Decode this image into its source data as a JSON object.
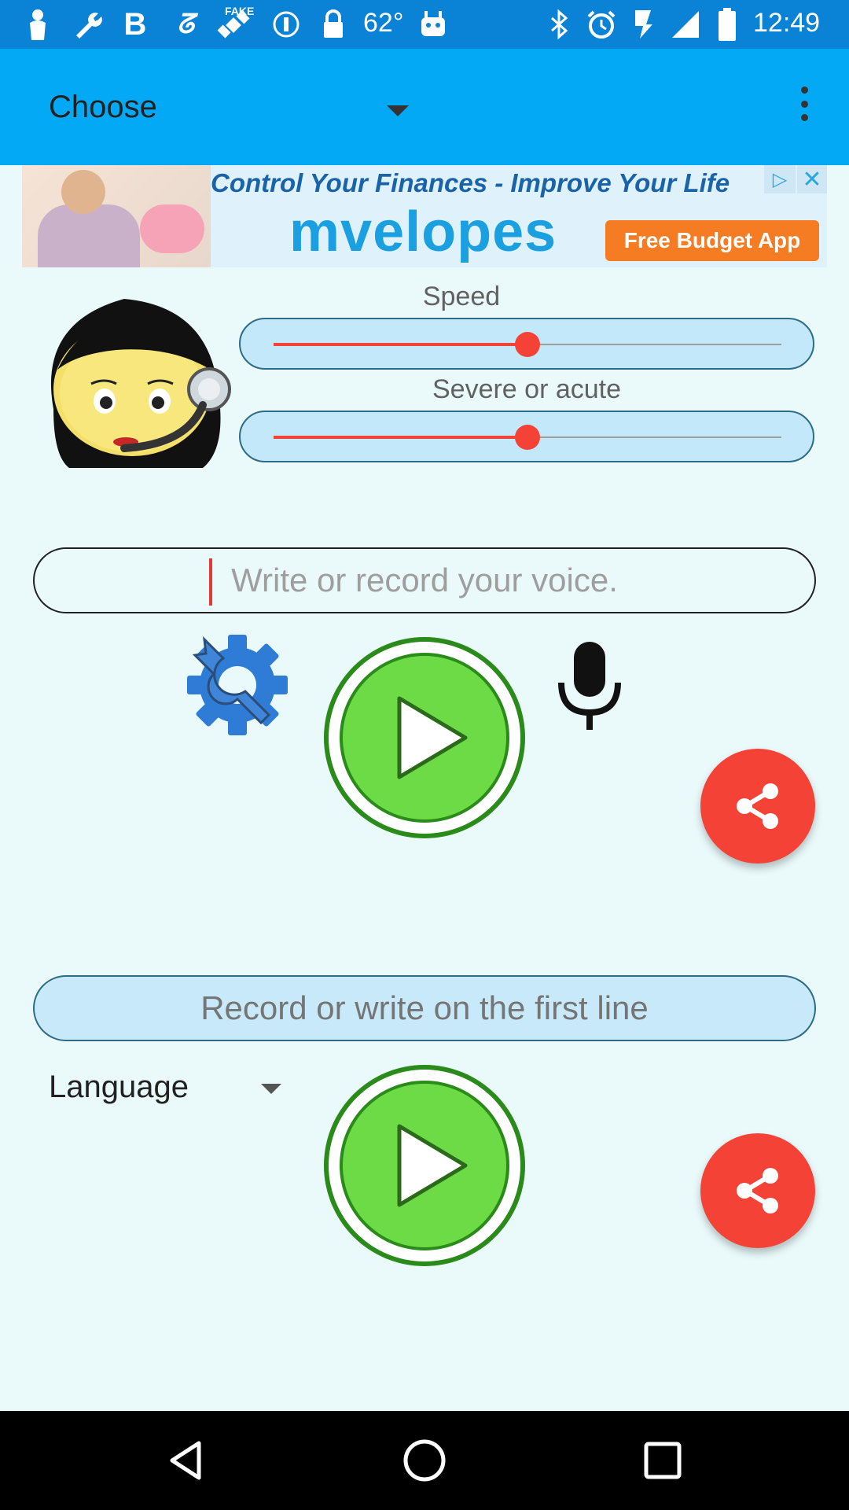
{
  "status_bar": {
    "temperature": "62°",
    "time": "12:49",
    "fake_label": "FAKE"
  },
  "app_bar": {
    "title": "Choose"
  },
  "ad": {
    "tagline": "Control Your Finances - Improve Your Life",
    "brand": "mvelopes",
    "cta": "Free Budget App",
    "brand_color": "#1aa0e0",
    "cta_color": "#f57c22"
  },
  "speed": {
    "label": "Speed",
    "value": 0.5
  },
  "pitch": {
    "label": "Severe or acute",
    "value": 0.5
  },
  "input": {
    "placeholder": "Write or record your voice."
  },
  "output": {
    "text": "Record or write on the first line"
  },
  "language": {
    "label": "Language"
  },
  "colors": {
    "appbar": "#03a9f4",
    "statusbar": "#0a82d6",
    "accent": "#f44336",
    "play": "#6ddb46",
    "gear": "#2e7cd6",
    "background": "#eafafb"
  }
}
